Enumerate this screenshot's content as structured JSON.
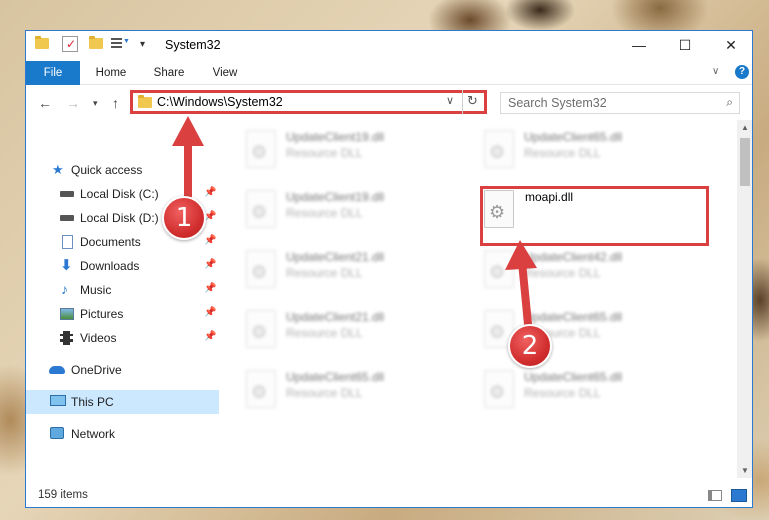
{
  "window": {
    "title": "System32",
    "controls": {
      "minimize": "—",
      "maximize": "☐",
      "close": "✕"
    }
  },
  "ribbon": {
    "tabs": [
      "File",
      "Home",
      "Share",
      "View"
    ]
  },
  "address": {
    "path": "C:\\Windows\\System32",
    "search_placeholder": "Search System32"
  },
  "nav_pane": {
    "quick_access": "Quick access",
    "items": [
      {
        "label": "Local Disk (C:)",
        "icon": "drive-icon",
        "pinned": true
      },
      {
        "label": "Local Disk (D:)",
        "icon": "drive-icon",
        "pinned": true
      },
      {
        "label": "Documents",
        "icon": "documents-icon",
        "pinned": true
      },
      {
        "label": "Downloads",
        "icon": "downloads-icon",
        "pinned": true
      },
      {
        "label": "Music",
        "icon": "music-icon",
        "pinned": true
      },
      {
        "label": "Pictures",
        "icon": "pictures-icon",
        "pinned": true
      },
      {
        "label": "Videos",
        "icon": "videos-icon",
        "pinned": true
      }
    ],
    "onedrive": "OneDrive",
    "this_pc": "This PC",
    "network": "Network"
  },
  "files": [
    {
      "name": "UpdateClient19.dll",
      "type": "Resource DLL"
    },
    {
      "name": "UpdateClient65.dll",
      "type": "Resource DLL"
    },
    {
      "name": "UpdateClient19.dll",
      "type": "Resource DLL"
    },
    {
      "name": "moapi.dll",
      "type": ""
    },
    {
      "name": "UpdateClient21.dll",
      "type": "Resource DLL"
    },
    {
      "name": "UpdateClient42.dll",
      "type": "Resource DLL"
    },
    {
      "name": "UpdateClient21.dll",
      "type": "Resource DLL"
    },
    {
      "name": "UpdateClient65.dll",
      "type": "Resource DLL"
    },
    {
      "name": "UpdateClient65.dll",
      "type": "Resource DLL"
    },
    {
      "name": "UpdateClient65.dll",
      "type": "Resource DLL"
    }
  ],
  "status": {
    "item_count": "159 items"
  },
  "annotations": {
    "step1": "1",
    "step2": "2"
  },
  "colors": {
    "accent": "#1979ca",
    "highlight": "#d9403f",
    "selected": "#cce8ff"
  }
}
